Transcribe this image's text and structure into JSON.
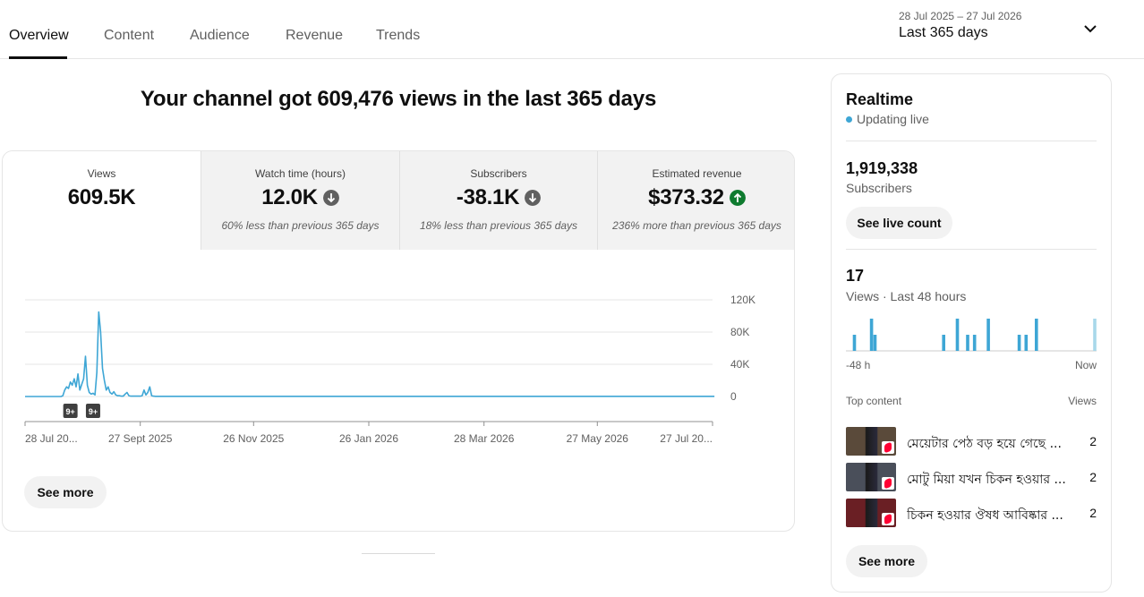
{
  "tabs": [
    {
      "label": "Overview",
      "active": true
    },
    {
      "label": "Content",
      "active": false
    },
    {
      "label": "Audience",
      "active": false
    },
    {
      "label": "Revenue",
      "active": false
    },
    {
      "label": "Trends",
      "active": false
    }
  ],
  "date_range": {
    "range_text": "28 Jul 2025 – 27 Jul 2026",
    "label": "Last 365 days",
    "icon": "chevron-down-icon"
  },
  "headline": "Your channel got 609,476 views in the last 365 days",
  "metrics": [
    {
      "label": "Views",
      "value": "609.5K",
      "note": "",
      "trend": "none",
      "selected": true
    },
    {
      "label": "Watch time (hours)",
      "value": "12.0K",
      "note": "60% less than previous 365 days",
      "trend": "down",
      "selected": false
    },
    {
      "label": "Subscribers",
      "value": "-38.1K",
      "note": "18% less than previous 365 days",
      "trend": "down",
      "selected": false
    },
    {
      "label": "Estimated revenue",
      "value": "$373.32",
      "note": "236% more than previous 365 days",
      "trend": "up",
      "selected": false
    }
  ],
  "colors": {
    "line": "#3ea6d5",
    "trend_down": "#606060",
    "trend_up": "#0f7b2f",
    "grid": "#e5e5e5",
    "badge_bg": "#3f3f3f"
  },
  "chart_data": {
    "type": "line",
    "series": [
      {
        "x": [
          0,
          1,
          2,
          3,
          4,
          5,
          6,
          7,
          8,
          9,
          10,
          11,
          12,
          13,
          14,
          15,
          16,
          17,
          18,
          19,
          20,
          21,
          22,
          23,
          24,
          25,
          26,
          27,
          28,
          29,
          30,
          31,
          32,
          33,
          34,
          35,
          36,
          37,
          38,
          39,
          40,
          41,
          42,
          43,
          44,
          45,
          46,
          47,
          48,
          49,
          50,
          51,
          52,
          53,
          54,
          55,
          56,
          57,
          58,
          59,
          60,
          61,
          62,
          63,
          64,
          65,
          66,
          67,
          68,
          69,
          70,
          71,
          72,
          73,
          74,
          75,
          76,
          77,
          78,
          79,
          80,
          81,
          82,
          83,
          84,
          85,
          86,
          87,
          88,
          89,
          90,
          91,
          92,
          93,
          94,
          95,
          96,
          97,
          98,
          99,
          100,
          365
        ],
        "values": [
          0,
          0,
          0,
          0,
          0,
          0,
          0,
          0,
          0,
          0,
          0,
          0,
          0,
          0,
          0,
          0,
          0,
          0,
          0,
          0,
          1000,
          8000,
          12000,
          10000,
          18000,
          14000,
          22000,
          12000,
          28000,
          8000,
          15000,
          22000,
          50000,
          14000,
          5000,
          3000,
          4000,
          2000,
          30000,
          105000,
          80000,
          35000,
          20000,
          8000,
          12000,
          5000,
          3000,
          6000,
          2000,
          1000,
          1000,
          500,
          500,
          3000,
          5000,
          1000,
          500,
          500,
          500,
          500,
          500,
          500,
          1000,
          8000,
          2000,
          5000,
          12000,
          1000,
          500,
          200,
          200,
          200,
          200,
          200,
          200,
          200,
          200,
          200,
          200,
          200,
          200,
          200,
          200,
          200,
          200,
          200,
          200,
          200,
          200,
          200,
          200,
          200,
          200,
          200,
          200,
          200,
          200,
          200,
          200,
          200,
          200,
          200
        ]
      }
    ],
    "x_tick_labels": [
      "28 Jul 20...",
      "27 Sept 2025",
      "26 Nov 2025",
      "26 Jan 2026",
      "28 Mar 2026",
      "27 May 2026",
      "27 Jul 20..."
    ],
    "x_tick_days": [
      0,
      61,
      121,
      182,
      243,
      303,
      364
    ],
    "x_range": [
      0,
      364
    ],
    "y_tick_labels": [
      "120K",
      "80K",
      "40K",
      "0"
    ],
    "y_ticks": [
      120000,
      80000,
      40000,
      0
    ],
    "ylim": [
      0,
      120000
    ],
    "grid": true,
    "annotations": [
      {
        "label": "9+",
        "day": 24
      },
      {
        "label": "9+",
        "day": 36
      }
    ]
  },
  "main_see_more": "See more",
  "realtime": {
    "title": "Realtime",
    "status": "Updating live",
    "subscribers_value": "1,919,338",
    "subscribers_label": "Subscribers",
    "live_count_button": "See live count",
    "views_value": "17",
    "views_label": "Views · Last 48 hours",
    "bar_chart": {
      "type": "bar",
      "values": [
        0,
        0,
        1,
        0,
        0,
        0,
        0,
        2,
        1,
        0,
        0,
        0,
        0,
        0,
        0,
        0,
        0,
        0,
        0,
        0,
        0,
        0,
        0,
        0,
        0,
        0,
        0,
        0,
        1,
        0,
        0,
        0,
        2,
        0,
        0,
        1,
        0,
        1,
        0,
        0,
        0,
        2,
        0,
        0,
        0,
        0,
        0,
        0,
        0,
        0,
        1,
        0,
        1,
        0,
        0,
        2,
        0,
        0,
        0,
        0,
        0,
        0,
        0,
        0,
        0,
        0,
        0,
        0,
        0,
        0,
        0,
        0,
        2
      ],
      "x_start_label": "-48 h",
      "x_end_label": "Now",
      "color": "#3ea6d5",
      "latest_color": "#a8d8ea"
    },
    "top_content_label": "Top content",
    "views_col_label": "Views",
    "top_content": [
      {
        "title": "মেয়েটার পেঠ বড় হয়ে গেছে ...",
        "views": "2",
        "thumb_color": "#5a4a3a"
      },
      {
        "title": "মোটু মিয়া যখন চিকন হওয়ার ...",
        "views": "2",
        "thumb_color": "#4a4f5a"
      },
      {
        "title": "চিকন হওয়ার ঔষধ আবিষ্কার ...",
        "views": "2",
        "thumb_color": "#6a1f24"
      }
    ],
    "see_more": "See more"
  }
}
